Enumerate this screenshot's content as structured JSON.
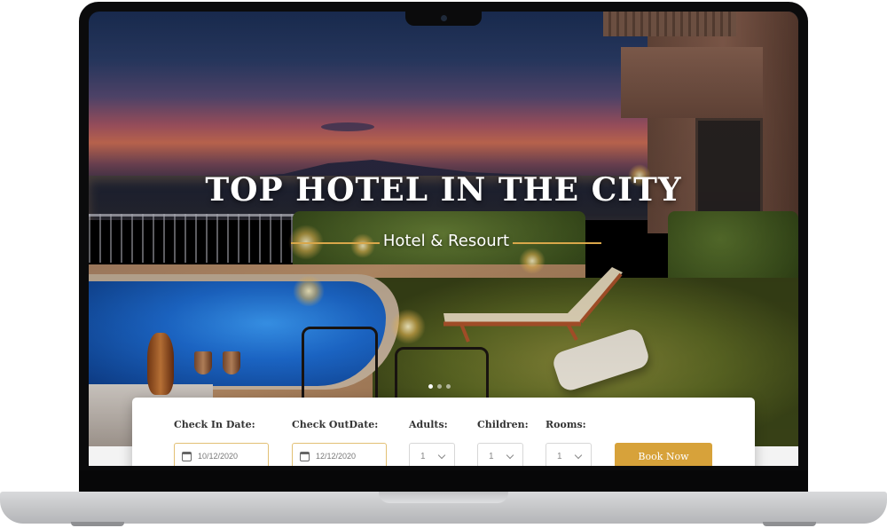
{
  "hero": {
    "title": "TOP HOTEL IN THE CITY",
    "subtitle": "Hotel & Resourt",
    "slides_total": 3,
    "slide_active": 1
  },
  "booking": {
    "check_in": {
      "label": "Check In Date:",
      "value": "10/12/2020",
      "icon": "calendar-icon"
    },
    "check_out": {
      "label": "Check OutDate:",
      "value": "12/12/2020",
      "icon": "calendar-icon"
    },
    "adults": {
      "label": "Adults:",
      "value": "1"
    },
    "children": {
      "label": "Children:",
      "value": "1"
    },
    "rooms": {
      "label": "Rooms:",
      "value": "1"
    },
    "button_label": "Book Now"
  },
  "colors": {
    "accent": "#d7a23a",
    "input_border": "#e2c074",
    "hero_text": "#ffffff"
  }
}
